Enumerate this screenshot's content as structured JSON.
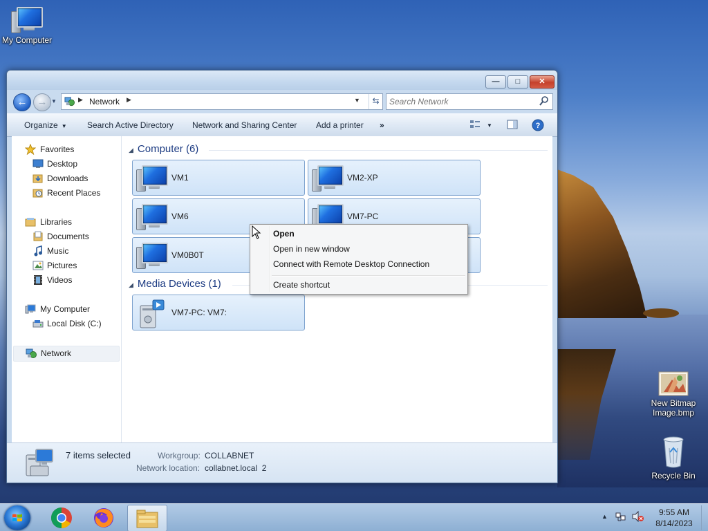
{
  "desktop": {
    "icons": [
      {
        "label": "My Computer"
      },
      {
        "label": "New Bitmap Image.bmp"
      },
      {
        "label": "Recycle Bin"
      }
    ]
  },
  "window": {
    "address": {
      "crumb": "Network"
    },
    "search": {
      "placeholder": "Search Network"
    },
    "commands": {
      "organize": "Organize",
      "search_ad": "Search Active Directory",
      "sharing_center": "Network and Sharing Center",
      "add_printer": "Add a printer",
      "more": "»"
    },
    "nav": {
      "favorites": "Favorites",
      "desktop": "Desktop",
      "downloads": "Downloads",
      "recent_places": "Recent Places",
      "libraries": "Libraries",
      "documents": "Documents",
      "music": "Music",
      "pictures": "Pictures",
      "videos": "Videos",
      "my_computer": "My Computer",
      "local_disk": "Local Disk (C:)",
      "network": "Network"
    },
    "groups": {
      "computer": "Computer (6)",
      "media": "Media Devices (1)"
    },
    "computers": [
      {
        "name": "VM1"
      },
      {
        "name": "VM2-XP"
      },
      {
        "name": "VM6"
      },
      {
        "name": "VM7-PC"
      },
      {
        "name": "VM0B0T"
      },
      {
        "name": ""
      }
    ],
    "media_devices": [
      {
        "name": "VM7-PC: VM7:"
      }
    ],
    "status": {
      "selected": "7 items selected",
      "workgroup_label": "Workgroup:",
      "workgroup": "COLLABNET",
      "location_label": "Network location:",
      "location": "collabnet.local  2"
    }
  },
  "context_menu": {
    "open": "Open",
    "open_new_window": "Open in new window",
    "remote_desktop": "Connect with Remote Desktop Connection",
    "create_shortcut": "Create shortcut"
  },
  "taskbar": {
    "time": "9:55 AM",
    "date": "8/14/2023"
  }
}
